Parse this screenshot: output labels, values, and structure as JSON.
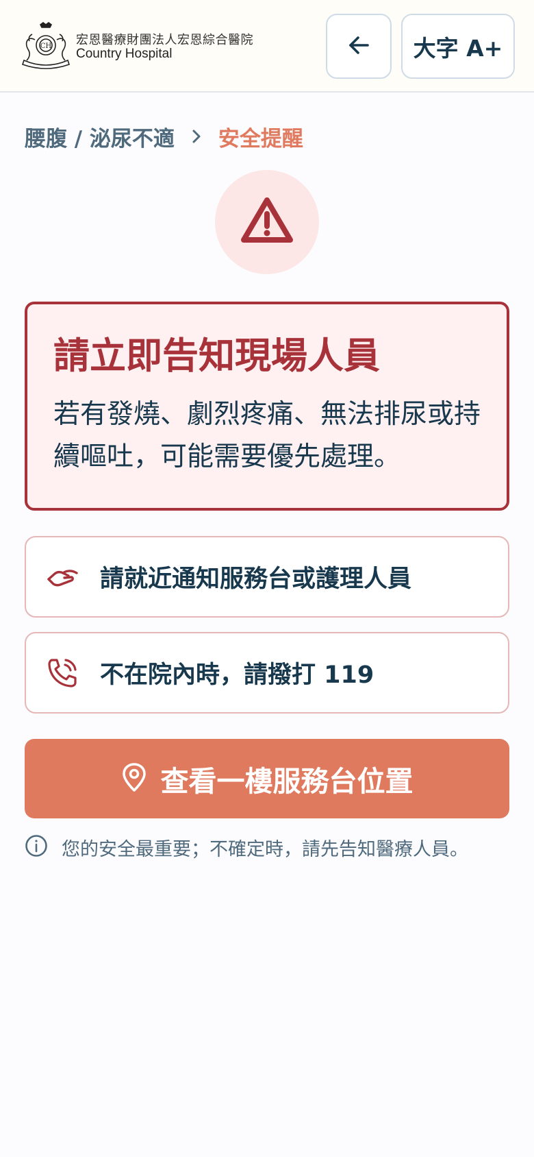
{
  "header": {
    "brand_cn": "宏恩醫療財團法人宏恩綜合醫院",
    "brand_en": "Country Hospital",
    "font_button_label": "大字 A+"
  },
  "breadcrumb": {
    "parent": "腰腹 / 泌尿不適",
    "current": "安全提醒"
  },
  "alert": {
    "title": "請立即告知現場人員",
    "body": "若有發燒、劇烈疼痛、無法排尿或持續嘔吐，可能需要優先處理。"
  },
  "actions": [
    {
      "icon": "helping-hand-icon",
      "label": "請就近通知服務台或護理人員"
    },
    {
      "icon": "phone-call-icon",
      "label": "不在院內時，請撥打 119"
    }
  ],
  "cta": {
    "icon": "map-pin-icon",
    "label": "查看一樓服務台位置"
  },
  "note": {
    "icon": "info-icon",
    "text": "您的安全最重要；不確定時，請先告知醫療人員。"
  },
  "colors": {
    "accent": "#e07a5f",
    "danger": "#a8323a",
    "text": "#17384d"
  }
}
